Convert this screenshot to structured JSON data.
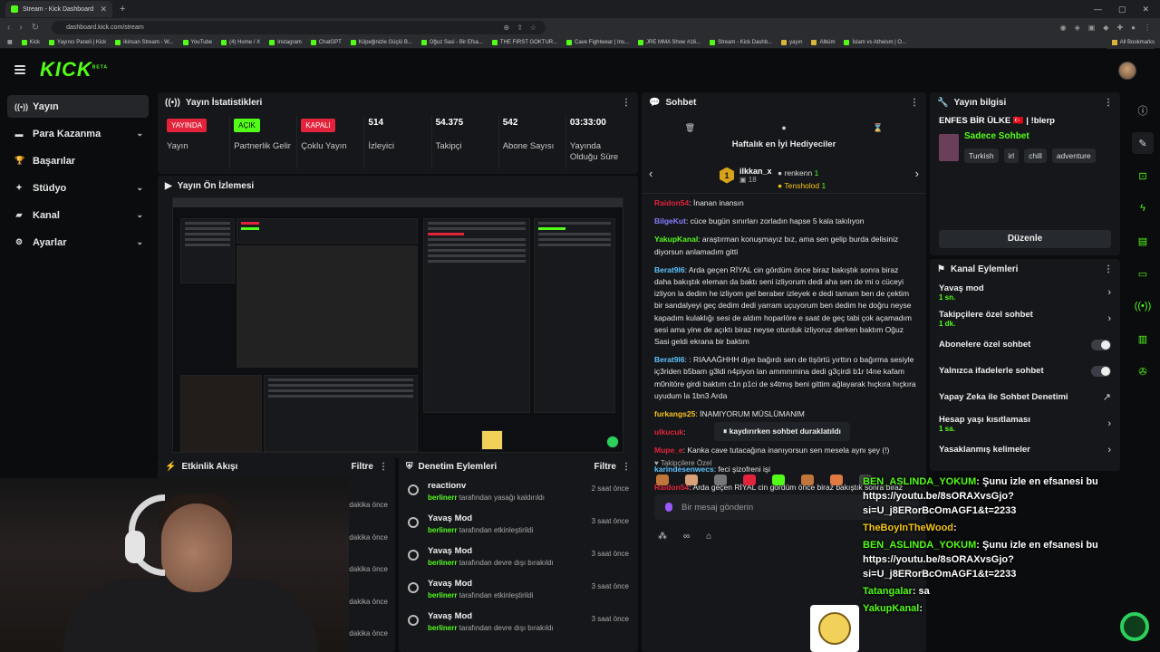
{
  "browser": {
    "tab_title": "Stream - Kick Dashboard",
    "url": "dashboard.kick.com/stream",
    "bookmarks": [
      "Kick",
      "Yayıncı Paneli | Kick",
      "ikinsan Stream - W...",
      "YouTube",
      "(4) Home / X",
      "Instagram",
      "ChatGPT",
      "Köpeğinizle Güçlü B...",
      "Oğuz Sasi - Bir Efsa...",
      "THE FIRST GOKTUR...",
      "Cave Fightwear | Ins...",
      "JRE MMA Show #16...",
      "Stream - Kick Dashb...",
      "yayın",
      "Albüm",
      "İslam vs Atheism | O..."
    ],
    "all_bookmarks": "All Bookmarks"
  },
  "app": {
    "logo": "KICK",
    "logo_beta": "BETA"
  },
  "sidebar": {
    "items": [
      {
        "label": "Yayın"
      },
      {
        "label": "Para Kazanma"
      },
      {
        "label": "Başarılar"
      },
      {
        "label": "Stüdyo"
      },
      {
        "label": "Kanal"
      },
      {
        "label": "Ayarlar"
      }
    ]
  },
  "stats_panel": {
    "title": "Yayın İstatistikleri",
    "items": [
      {
        "value": "YAYINDA",
        "label": "Yayın",
        "kind": "red"
      },
      {
        "value": "AÇIK",
        "label": "Partnerlik Gelir",
        "kind": "green"
      },
      {
        "value": "KAPALI",
        "label": "Çoklu Yayın",
        "kind": "red"
      },
      {
        "value": "514",
        "label": "İzleyici"
      },
      {
        "value": "54.375",
        "label": "Takipçi"
      },
      {
        "value": "542",
        "label": "Abone Sayısı"
      },
      {
        "value": "03:33:00",
        "label": "Yayında Olduğu Süre"
      }
    ]
  },
  "preview_panel": {
    "title": "Yayın Ön İzlemesi"
  },
  "activity_panel": {
    "title": "Etkinlik Akışı",
    "filter": "Filtre",
    "times": [
      "dakika önce",
      "dakika önce",
      "dakika önce",
      "dakika önce",
      "dakika önce"
    ]
  },
  "moderation_panel": {
    "title": "Denetim Eylemleri",
    "filter": "Filtre",
    "rows": [
      {
        "title": "reactionv",
        "user": "berlinerr",
        "action": "tarafından yasağı kaldırıldı",
        "time": "2 saat önce"
      },
      {
        "title": "Yavaş Mod",
        "user": "berlinerr",
        "action": "tarafından etkinleştirildi",
        "time": "3 saat önce"
      },
      {
        "title": "Yavaş Mod",
        "user": "berlinerr",
        "action": "tarafından devre dışı bırakıldı",
        "time": "3 saat önce"
      },
      {
        "title": "Yavaş Mod",
        "user": "berlinerr",
        "action": "tarafından etkinleştirildi",
        "time": "3 saat önce"
      },
      {
        "title": "Yavaş Mod",
        "user": "berlinerr",
        "action": "tarafından devre dışı bırakıldı",
        "time": "3 saat önce"
      }
    ]
  },
  "chat_panel": {
    "title": "Sohbet",
    "gifts_title": "Haftalık en İyi Hediyeciler",
    "top_gifter": {
      "rank": "1",
      "name": "ilkkan_x",
      "count": "18"
    },
    "gifters": [
      {
        "name": "renkenn",
        "count": "1"
      },
      {
        "name": "Tensholod",
        "count": "1"
      }
    ],
    "messages": [
      {
        "user": "Raidon54",
        "color": "#e3223b",
        "text": ": İnanan inansın"
      },
      {
        "user": "BilgeKut",
        "color": "#8a7dff",
        "text": ": cüce bugün sınırları zorladın hapse 5 kala takılıyon"
      },
      {
        "user": "YakupKanal",
        "color": "#53fc18",
        "text": ": araştırman konuşmayız bız, ama sen gelip burda delisiniz diyorsun anlamadım gitti"
      },
      {
        "user": "Berat9l6",
        "color": "#5ec3ff",
        "text": ": Arda geçen RİYAL cin gördüm önce biraz bakıştık sonra biraz daha bakıştık eleman da baktı seni izliyorum dedi aha sen de mi o cüceyi izliyon la dedim he izliyom gel beraber izleyek e dedi tamam ben de çektim bir sandalyeyi geç dedim dedi yarram uçuyorum ben dedim he doğru neyse kapadım kulaklığı sesi de aldım hoparlöre e saat de geç tabi çok açamadım sesi ama yine de açıktı biraz neyse oturduk izliyoruz derken baktım Oğuz Sasi geldi ekrana bir baktım"
      },
      {
        "user": "Berat9l6",
        "color": "#5ec3ff",
        "text": ": : RIAAAĞHHH diye bağırdı sen de tişörtü yırttın o bağırma sesiyle iç3riden b5bam g3ldi n4piyon lan ammmmina dedi g3çirdi b1r t4ne kafam m0nitöre girdi baktım c1n p1ci de s4tmış beni gittim ağlayarak hıçkıra hıçkıra uyudum la 1bn3 Arda"
      },
      {
        "user": "furkangs25",
        "color": "#f5c518",
        "text": ": İNAMIYORUM MÜSLÜMANIM"
      },
      {
        "user": "ulkucuk",
        "color": "#e3223b",
        "text": ":"
      },
      {
        "user": "Mupe_e",
        "color": "#e3223b",
        "text": ": Kanka cave tutacağına inanıyorsun sen mesela aynı şey (!)"
      },
      {
        "user": "karindesenwecs",
        "color": "#5ec3ff",
        "text": ": feci şizofreni işi"
      },
      {
        "user": "Raidon54",
        "color": "#e3223b",
        "text": ": Arda geçen RİYAL cin gördüm önce biraz bakıştık sonra biraz daha bakı... o cüceyi izliyon"
      }
    ],
    "paused_label": "kaydırırken sohbet duraklatıldı",
    "followers_label": "Takipçilere Özel",
    "input_placeholder": "Bir mesaj gönderin"
  },
  "stream_info": {
    "title": "Yayın bilgisi",
    "stream_title": "ENFES BİR ÜLKE 🇹🇷 | !blerp",
    "category": "Sadece Sohbet",
    "tags": [
      "Turkish",
      "irl",
      "chill",
      "adventure"
    ],
    "edit_label": "Düzenle"
  },
  "channel_actions": {
    "title": "Kanal Eylemleri",
    "rows": [
      {
        "title": "Yavaş mod",
        "sub": "1 sn.",
        "control": "chevron"
      },
      {
        "title": "Takipçilere özel sohbet",
        "sub": "1 dk.",
        "control": "chevron"
      },
      {
        "title": "Abonelere özel sohbet",
        "sub": "",
        "control": "toggle"
      },
      {
        "title": "Yalnızca ifadelerle sohbet",
        "sub": "",
        "control": "toggle"
      },
      {
        "title": "Yapay Zeka ile Sohbet Denetimi",
        "sub": "",
        "control": "external"
      },
      {
        "title": "Hesap yaşı kısıtlaması",
        "sub": "1 sa.",
        "control": "chevron"
      },
      {
        "title": "Yasaklanmış kelimeler",
        "sub": "",
        "control": "chevron"
      }
    ]
  },
  "overlay_chat": [
    {
      "user": "BEN_ASLINDA_YOKUM",
      "color": "#53fc18",
      "text": ": Şunu izle en efsanesi bu https://youtu.be/8sORAXvsGjo?si=U_j8ERorBcOmAGF1&t=2233"
    },
    {
      "user": "TheBoyInTheWood",
      "color": "#f5c518",
      "text": ":"
    },
    {
      "user": "BEN_ASLINDA_YOKUM",
      "color": "#53fc18",
      "text": ": Şunu izle en efsanesi bu https://youtu.be/8sORAXvsGjo?si=U_j8ERorBcOmAGF1&t=2233"
    },
    {
      "user": "Tatangalar",
      "color": "#53fc18",
      "text": ": sa"
    },
    {
      "user": "YakupKanal",
      "color": "#53fc18",
      "text": ":"
    }
  ]
}
